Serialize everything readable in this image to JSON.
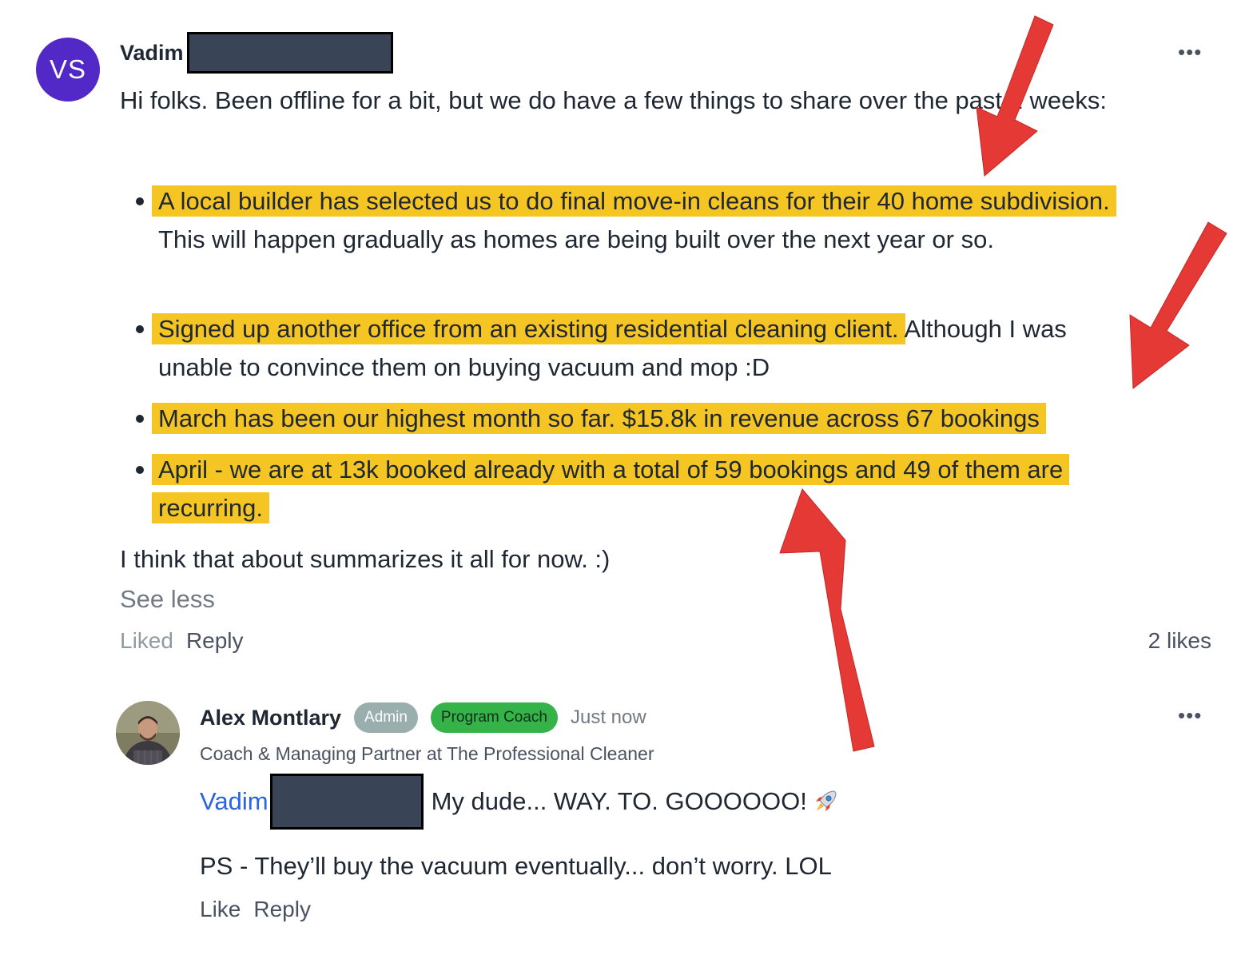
{
  "post": {
    "avatar_initials": "VS",
    "author_name": "Vadim",
    "intro": "Hi folks. Been offline for a bit, but we do have a few things to share over the past 2 weeks:",
    "bullets": [
      {
        "highlighted": "A local builder has selected us to do final move-in cleans for their 40 home subdivision.",
        "rest": " This will happen gradually as homes are being built over the next year or so."
      },
      {
        "highlighted": "Signed up another office from an existing residential cleaning client.",
        "rest": " Although I was unable to convince them on buying vacuum and mop :D"
      },
      {
        "highlighted": "March has been our highest month so far. $15.8k in revenue across 67 bookings",
        "rest": ""
      },
      {
        "highlighted": "April - we are at 13k booked already with a total of 59 bookings and 49 of them are recurring.",
        "rest": ""
      }
    ],
    "closing": "I think that about summarizes it all for now. :)",
    "see_less": "See less",
    "liked_label": "Liked",
    "reply_label": "Reply",
    "likes_count": "2 likes",
    "more_label": "•••"
  },
  "reply": {
    "author_name": "Alex Montlary",
    "badge_admin": "Admin",
    "badge_coach": "Program Coach",
    "time": "Just now",
    "subtitle": "Coach & Managing Partner at The Professional Cleaner",
    "mention": "Vadim",
    "message": "My dude... WAY. TO. GOOOOOO!",
    "ps": "PS - They’ll buy the vacuum eventually... don’t worry. LOL",
    "like_label": "Like",
    "reply_label": "Reply",
    "more_label": "•••"
  },
  "colors": {
    "highlight": "#f5c523",
    "avatar": "#5229c7",
    "mention": "#2a64e0",
    "arrow": "#e53935",
    "badge_coach": "#35b349",
    "badge_admin": "#9aaeae"
  }
}
